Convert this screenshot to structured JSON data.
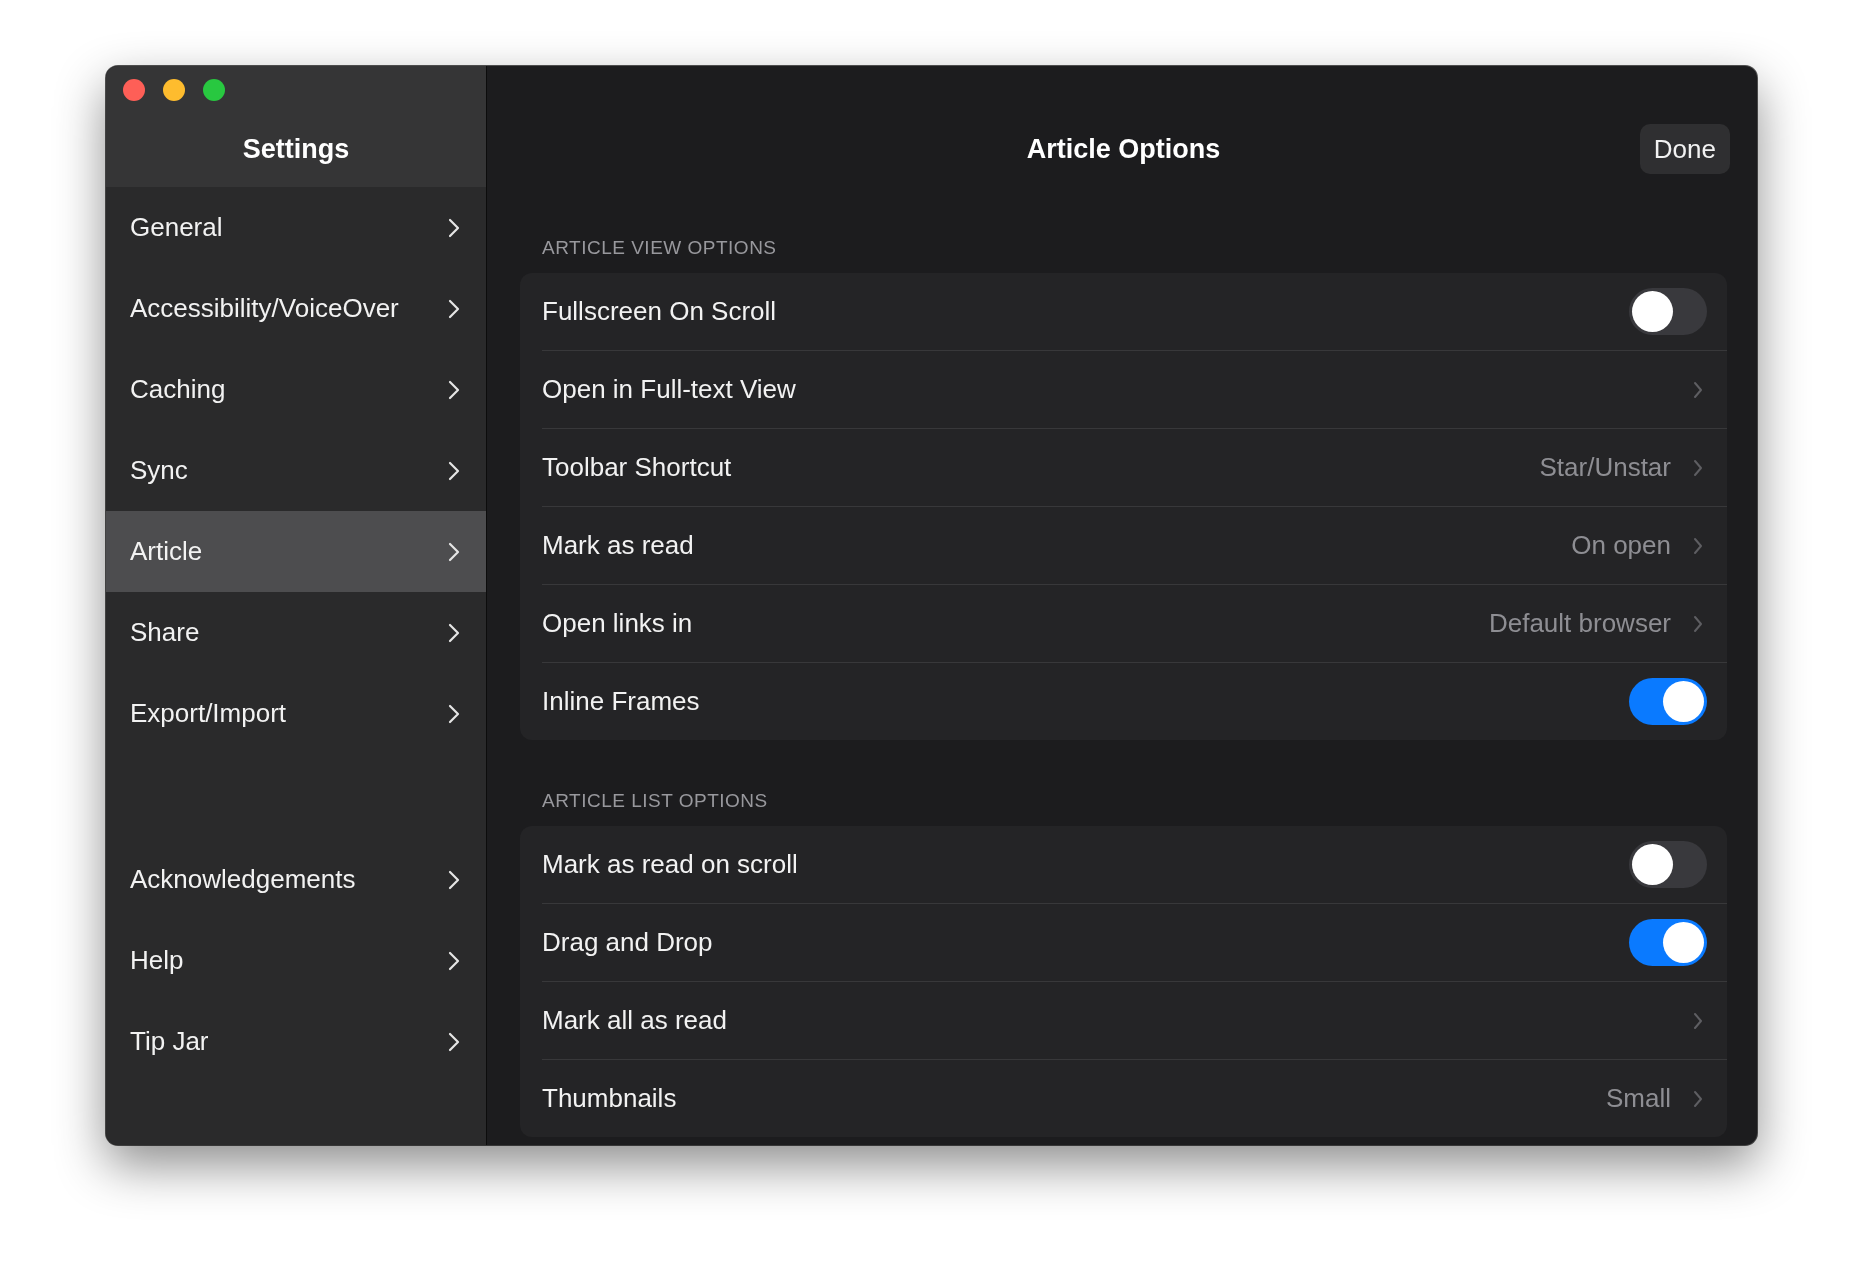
{
  "sidebar": {
    "title": "Settings",
    "groups": [
      {
        "items": [
          {
            "label": "General",
            "selected": false
          },
          {
            "label": "Accessibility/VoiceOver",
            "selected": false
          },
          {
            "label": "Caching",
            "selected": false
          },
          {
            "label": "Sync",
            "selected": false
          },
          {
            "label": "Article",
            "selected": true
          },
          {
            "label": "Share",
            "selected": false
          },
          {
            "label": "Export/Import",
            "selected": false
          }
        ]
      },
      {
        "items": [
          {
            "label": "Acknowledgements",
            "selected": false
          },
          {
            "label": "Help",
            "selected": false
          },
          {
            "label": "Tip Jar",
            "selected": false
          }
        ]
      }
    ]
  },
  "main": {
    "title": "Article Options",
    "done_button": "Done",
    "sections": [
      {
        "header": "ARTICLE VIEW OPTIONS",
        "rows": [
          {
            "kind": "toggle",
            "label": "Fullscreen On Scroll",
            "on": false
          },
          {
            "kind": "link",
            "label": "Open in Full-text View"
          },
          {
            "kind": "link",
            "label": "Toolbar Shortcut",
            "value": "Star/Unstar"
          },
          {
            "kind": "link",
            "label": "Mark as read",
            "value": "On open"
          },
          {
            "kind": "link",
            "label": "Open links in",
            "value": "Default browser"
          },
          {
            "kind": "toggle",
            "label": "Inline Frames",
            "on": true
          }
        ]
      },
      {
        "header": "ARTICLE LIST OPTIONS",
        "rows": [
          {
            "kind": "toggle",
            "label": "Mark as read on scroll",
            "on": false
          },
          {
            "kind": "toggle",
            "label": "Drag and Drop",
            "on": true
          },
          {
            "kind": "link",
            "label": "Mark all as read"
          },
          {
            "kind": "link",
            "label": "Thumbnails",
            "value": "Small"
          }
        ]
      }
    ]
  }
}
